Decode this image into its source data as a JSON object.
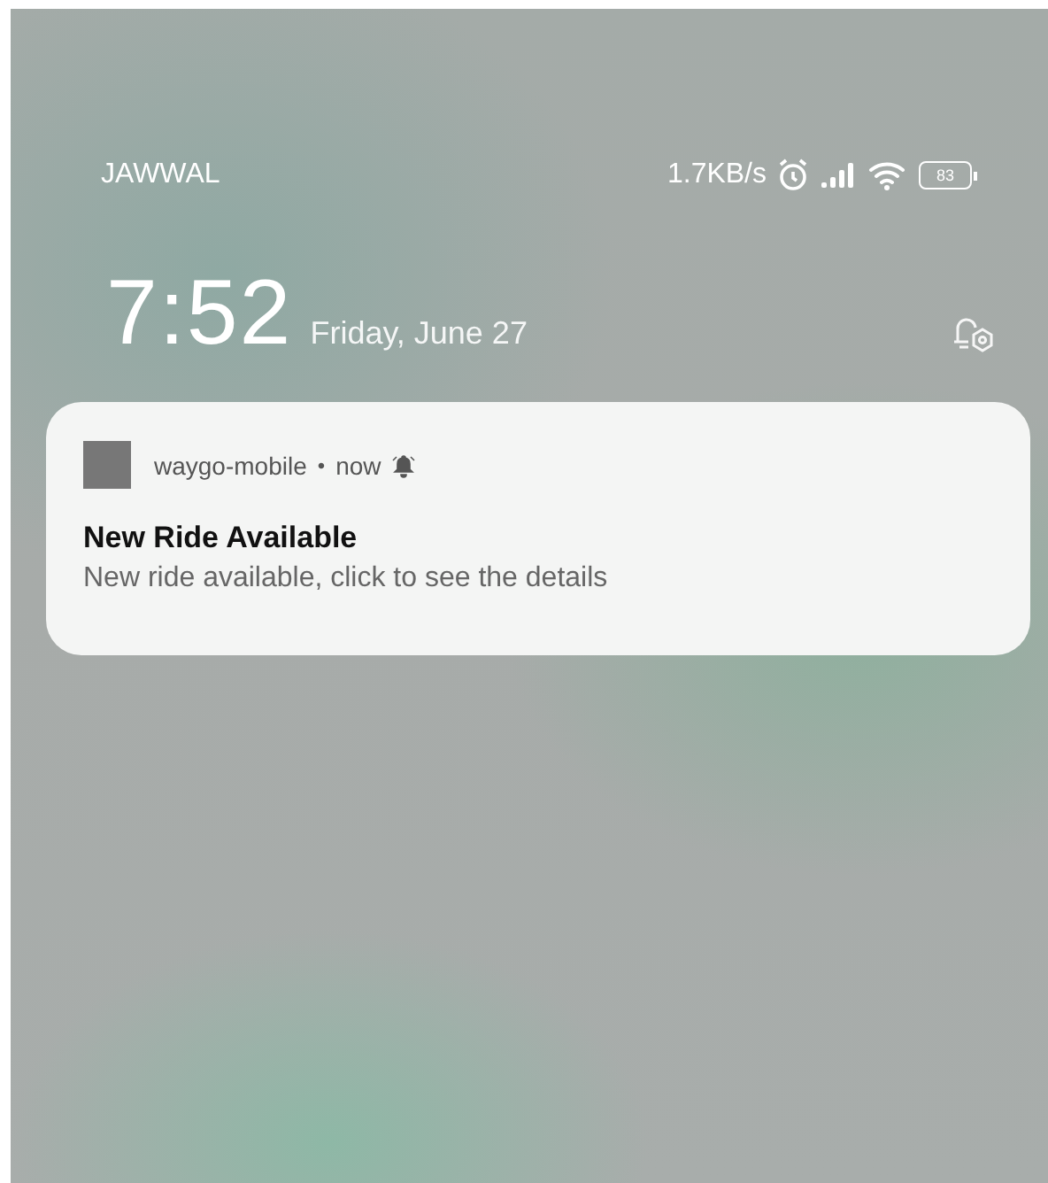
{
  "status_bar": {
    "carrier": "JAWWAL",
    "network_speed": "1.7KB/s",
    "battery": "83"
  },
  "lock_screen": {
    "time": "7:52",
    "date": "Friday, June 27"
  },
  "notification": {
    "app_name": "waygo-mobile",
    "separator": "•",
    "time": "now",
    "title": "New Ride Available",
    "body": "New ride available, click to see the details"
  }
}
